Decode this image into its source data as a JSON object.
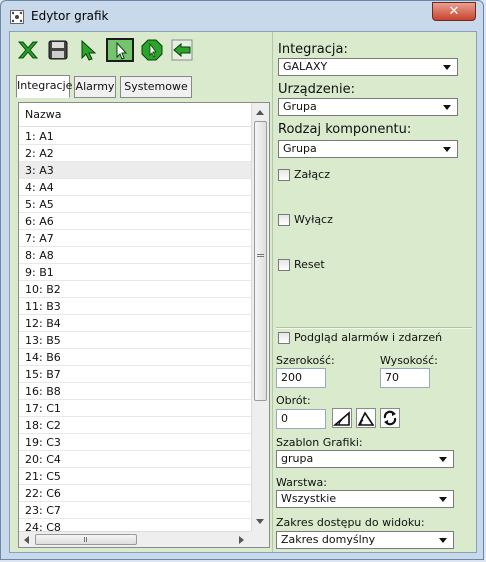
{
  "window": {
    "title": "Edytor grafik",
    "close_label": "✕"
  },
  "toolbar": {
    "items": [
      {
        "name": "delete-icon"
      },
      {
        "name": "save-icon"
      },
      {
        "name": "select-arrow-icon"
      },
      {
        "name": "select-arrow-active-icon"
      },
      {
        "name": "rotate-select-icon"
      },
      {
        "name": "back-arrow-icon"
      }
    ]
  },
  "tabs": [
    "Integracje",
    "Alarmy",
    "Systemowe"
  ],
  "list": {
    "header": "Nazwa",
    "rows": [
      "1: A1",
      "2: A2",
      "3: A3",
      "4: A4",
      "5: A5",
      "6: A6",
      "7: A7",
      "8: A8",
      "9: B1",
      "10: B2",
      "11: B3",
      "12: B4",
      "13: B5",
      "14: B6",
      "15: B7",
      "16: B8",
      "17: C1",
      "18: C2",
      "19: C3",
      "20: C4",
      "21: C5",
      "22: C6",
      "23: C7",
      "24: C8"
    ],
    "selected_index": 2
  },
  "integration": {
    "label": "Integracja:",
    "value": "GALAXY"
  },
  "device": {
    "label": "Urządzenie:",
    "value": "Grupa"
  },
  "component": {
    "label": "Rodzaj komponentu:",
    "value": "Grupa"
  },
  "checkboxes": {
    "on": "Załącz",
    "off": "Wyłącz",
    "reset": "Reset",
    "preview": "Podgląd alarmów i zdarzeń"
  },
  "width": {
    "label": "Szerokość:",
    "value": "200"
  },
  "height": {
    "label": "Wysokość:",
    "value": "70"
  },
  "rotation": {
    "label": "Obrót:",
    "value": "0"
  },
  "template": {
    "label": "Szablon Grafiki:",
    "value": "grupa"
  },
  "layer": {
    "label": "Warstwa:",
    "value": "Wszystkie"
  },
  "access": {
    "label": "Zakres dostępu do widoku:",
    "value": "Zakres domyślny"
  },
  "colors": {
    "client_bg": "#d9eacd",
    "accent_green": "#74c36e"
  }
}
